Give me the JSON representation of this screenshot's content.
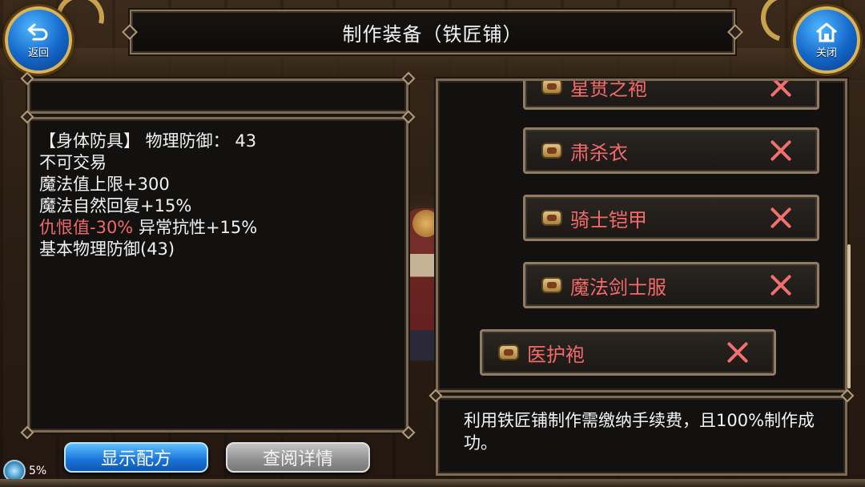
{
  "header": {
    "title": "制作装备（铁匠铺）",
    "back_label": "返回",
    "close_label": "关闭"
  },
  "details": {
    "lines": [
      {
        "type": "【身体防具】",
        "text": " 物理防御：  43"
      },
      {
        "text": "不可交易"
      },
      {
        "text": "魔法值上限+300"
      },
      {
        "text": "魔法自然回复+15%"
      },
      {
        "red": "仇恨值-30%",
        "text": " 异常抗性+15%"
      },
      {
        "text": "基本物理防御(43)"
      }
    ]
  },
  "recipes": {
    "items": [
      {
        "label": "星贯之袍"
      },
      {
        "label": "肃杀衣"
      },
      {
        "label": "骑士铠甲"
      },
      {
        "label": "魔法剑士服"
      },
      {
        "label": "医护袍"
      }
    ]
  },
  "info": {
    "text": "利用铁匠铺制作需缴纳手续费，且100%制作成功。"
  },
  "buttons": {
    "show_recipe": "显示配方",
    "view_details": "查阅详情"
  },
  "status": {
    "percent_label": "5%",
    "progress": 0.05
  },
  "colors": {
    "accent_red": "#f06a6a",
    "button_blue": "#1a72d8",
    "frame_gold": "#8f7c63"
  }
}
